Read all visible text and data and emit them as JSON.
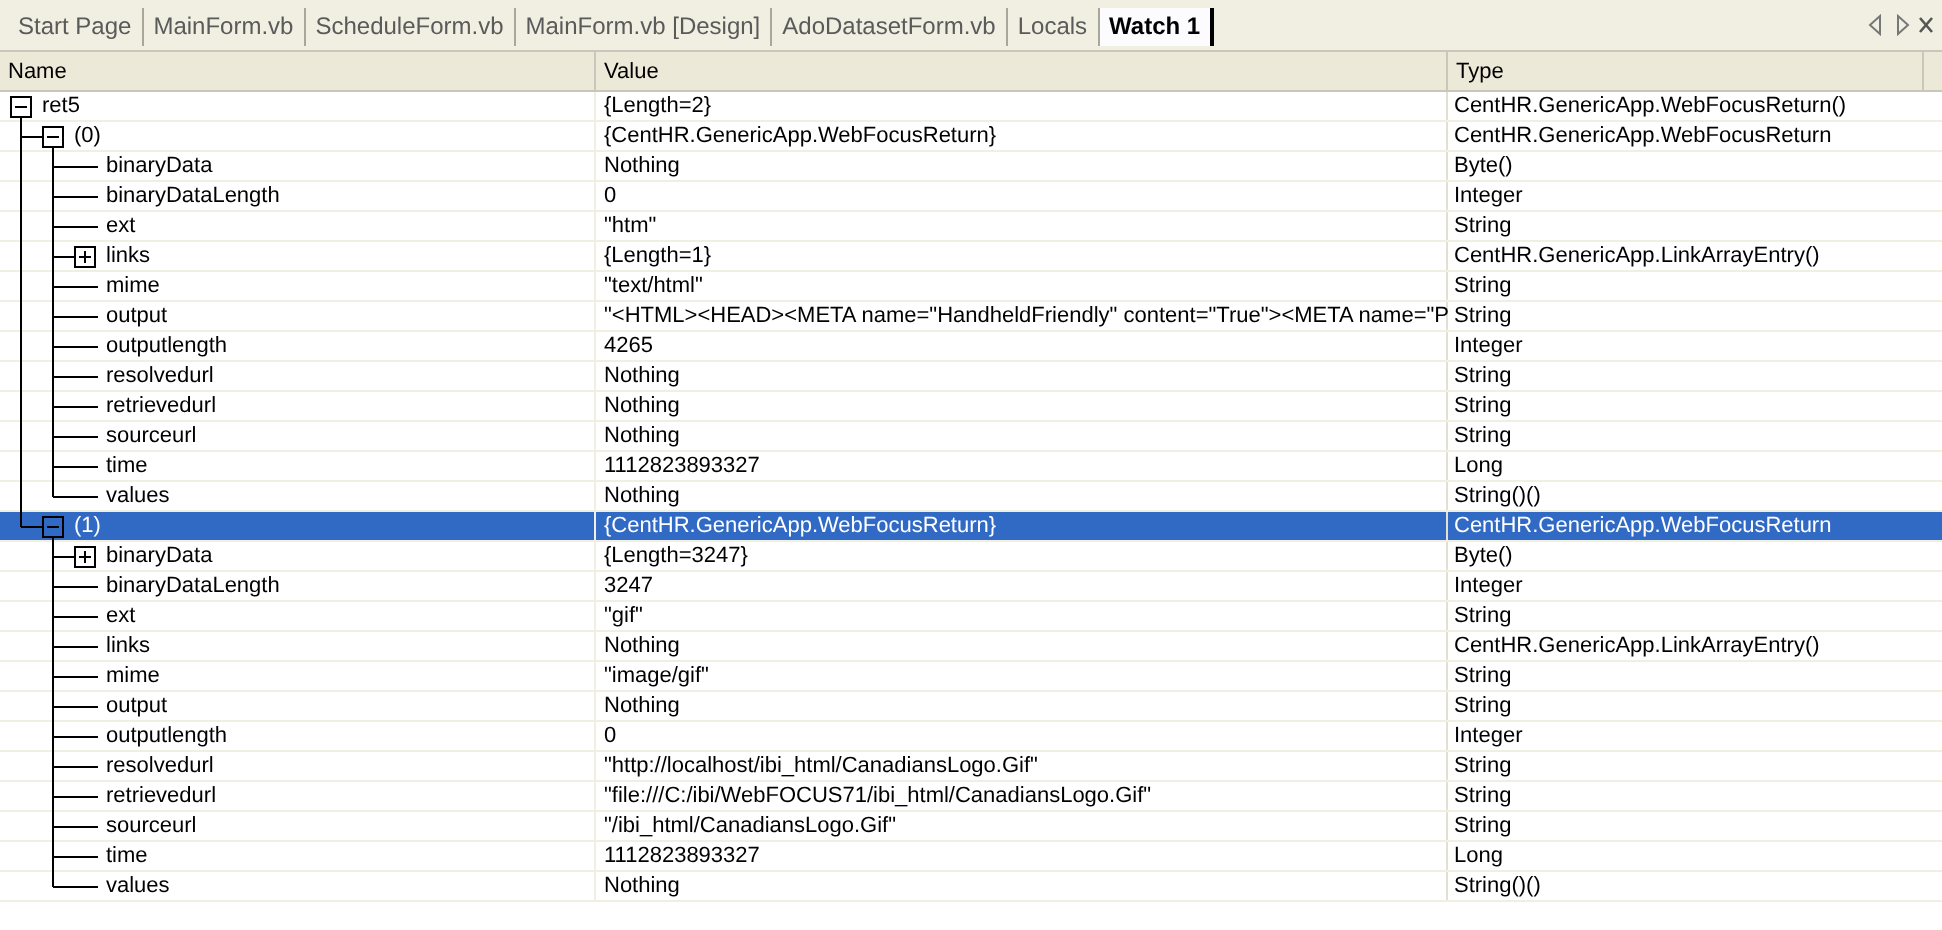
{
  "tabs": [
    {
      "label": "Start Page",
      "selected": false
    },
    {
      "label": "MainForm.vb",
      "selected": false
    },
    {
      "label": "ScheduleForm.vb",
      "selected": false
    },
    {
      "label": "MainForm.vb [Design]",
      "selected": false
    },
    {
      "label": "AdoDatasetForm.vb",
      "selected": false
    },
    {
      "label": "Locals",
      "selected": false
    },
    {
      "label": "Watch 1",
      "selected": true
    }
  ],
  "watch": {
    "columns": [
      "Name",
      "Value",
      "Type"
    ],
    "rows": [
      {
        "name": "ret5",
        "value": "{Length=2}",
        "type": "CentHR.GenericApp.WebFocusReturn()",
        "expanded": true,
        "selected": false,
        "children": [
          {
            "name": "(0)",
            "value": "{CentHR.GenericApp.WebFocusReturn}",
            "type": "CentHR.GenericApp.WebFocusReturn",
            "expanded": true,
            "selected": false,
            "children": [
              {
                "name": "binaryData",
                "value": "Nothing",
                "type": "Byte()",
                "selected": false
              },
              {
                "name": "binaryDataLength",
                "value": "0",
                "type": "Integer",
                "selected": false
              },
              {
                "name": "ext",
                "value": "\"htm\"",
                "type": "String",
                "selected": false
              },
              {
                "name": "links",
                "value": "{Length=1}",
                "type": "CentHR.GenericApp.LinkArrayEntry()",
                "expanded": false,
                "selected": false
              },
              {
                "name": "mime",
                "value": "\"text/html\"",
                "type": "String",
                "selected": false
              },
              {
                "name": "output",
                "value": "\"<HTML><HEAD><META name=\"HandheldFriendly\" content=\"True\"><META name=\"P",
                "type": "String",
                "selected": false
              },
              {
                "name": "outputlength",
                "value": "4265",
                "type": "Integer",
                "selected": false
              },
              {
                "name": "resolvedurl",
                "value": "Nothing",
                "type": "String",
                "selected": false
              },
              {
                "name": "retrievedurl",
                "value": "Nothing",
                "type": "String",
                "selected": false
              },
              {
                "name": "sourceurl",
                "value": "Nothing",
                "type": "String",
                "selected": false
              },
              {
                "name": "time",
                "value": "1112823893327",
                "type": "Long",
                "selected": false
              },
              {
                "name": "values",
                "value": "Nothing",
                "type": "String()()",
                "selected": false
              }
            ]
          },
          {
            "name": "(1)",
            "value": "{CentHR.GenericApp.WebFocusReturn}",
            "type": "CentHR.GenericApp.WebFocusReturn",
            "expanded": true,
            "selected": true,
            "children": [
              {
                "name": "binaryData",
                "value": "{Length=3247}",
                "type": "Byte()",
                "expanded": false,
                "selected": false
              },
              {
                "name": "binaryDataLength",
                "value": "3247",
                "type": "Integer",
                "selected": false
              },
              {
                "name": "ext",
                "value": "\"gif\"",
                "type": "String",
                "selected": false
              },
              {
                "name": "links",
                "value": "Nothing",
                "type": "CentHR.GenericApp.LinkArrayEntry()",
                "selected": false
              },
              {
                "name": "mime",
                "value": "\"image/gif\"",
                "type": "String",
                "selected": false
              },
              {
                "name": "output",
                "value": "Nothing",
                "type": "String",
                "selected": false
              },
              {
                "name": "outputlength",
                "value": "0",
                "type": "Integer",
                "selected": false
              },
              {
                "name": "resolvedurl",
                "value": "\"http://localhost/ibi_html/CanadiansLogo.Gif\"",
                "type": "String",
                "selected": false
              },
              {
                "name": "retrievedurl",
                "value": "\"file:///C:/ibi/WebFOCUS71/ibi_html/CanadiansLogo.Gif\"",
                "type": "String",
                "selected": false
              },
              {
                "name": "sourceurl",
                "value": "\"/ibi_html/CanadiansLogo.Gif\"",
                "type": "String",
                "selected": false
              },
              {
                "name": "time",
                "value": "1112823893327",
                "type": "Long",
                "selected": false
              },
              {
                "name": "values",
                "value": "Nothing",
                "type": "String()()",
                "selected": false
              }
            ]
          }
        ]
      }
    ]
  }
}
